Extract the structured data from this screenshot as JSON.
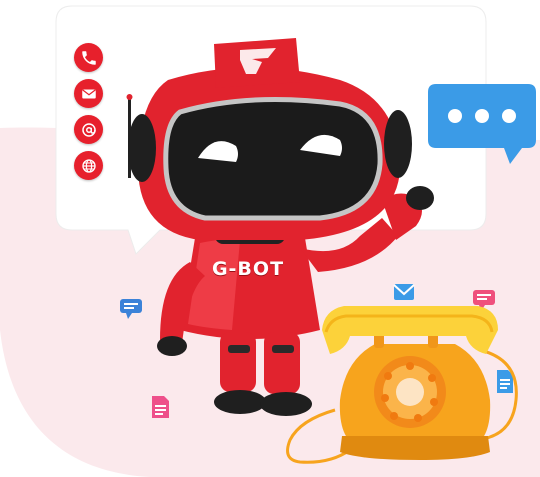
{
  "robot": {
    "label": "G-BOT",
    "logo_glyph": "G"
  },
  "contacts": [
    {
      "icon": "phone-icon"
    },
    {
      "icon": "mail-icon"
    },
    {
      "icon": "at-sign-icon"
    },
    {
      "icon": "globe-icon"
    }
  ],
  "colors": {
    "robot_red": "#e1232e",
    "accent_blue": "#3b9be7",
    "phone_orange": "#f7a41d",
    "bubble_white": "#ffffff",
    "background_pink": "#fbe9ec"
  }
}
